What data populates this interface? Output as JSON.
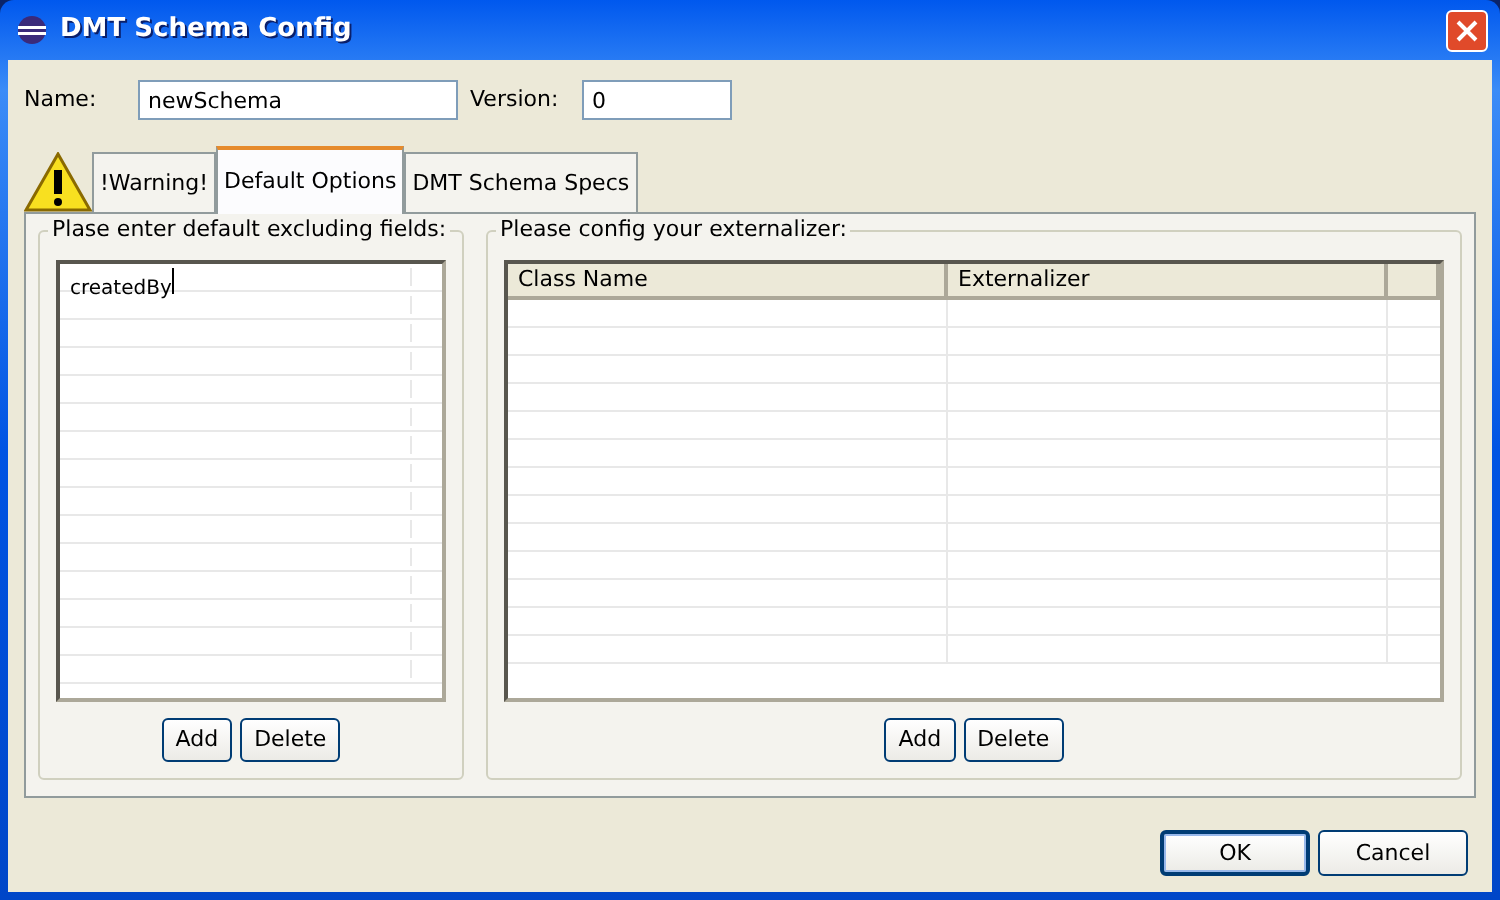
{
  "window": {
    "title": "DMT Schema Config"
  },
  "name_field": {
    "label": "Name:",
    "value": "newSchema"
  },
  "version_field": {
    "label": "Version:",
    "value": "0"
  },
  "tabs": [
    {
      "label": "!Warning!",
      "selected": false,
      "kind": "alert"
    },
    {
      "label": "Default Options",
      "selected": true,
      "kind": "plain"
    },
    {
      "label": "DMT Schema Specs",
      "selected": false,
      "kind": "plain"
    }
  ],
  "excluding_fields": {
    "title": "Plase enter default excluding fields:",
    "items": [
      "createdBy"
    ],
    "buttons": [
      "Add",
      "Delete"
    ]
  },
  "externalizer": {
    "title": "Please config your externalizer:",
    "columns": [
      "Class Name",
      "Externalizer"
    ],
    "buttons": [
      "Add",
      "Delete"
    ]
  },
  "buttons": [
    {
      "label": "OK",
      "default": true
    },
    {
      "label": "Cancel",
      "default": false
    }
  ]
}
